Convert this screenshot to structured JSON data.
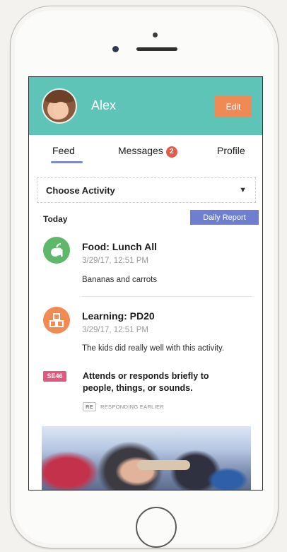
{
  "header": {
    "child_name": "Alex",
    "edit_label": "Edit"
  },
  "tabs": [
    {
      "label": "Feed",
      "active": true
    },
    {
      "label": "Messages",
      "badge": "2"
    },
    {
      "label": "Profile"
    }
  ],
  "filter": {
    "selected": "Choose Activity"
  },
  "feed": {
    "section_label": "Today",
    "daily_report_label": "Daily Report",
    "items": [
      {
        "title": "Food: Lunch All",
        "date": "3/29/17, 12:51 PM",
        "description": "Bananas and carrots",
        "icon": "apple-icon"
      },
      {
        "title": "Learning: PD20",
        "date": "3/29/17, 12:51 PM",
        "description": "The kids did really well with this activity.",
        "icon": "blocks-icon"
      }
    ],
    "milestone": {
      "tag": "SE46",
      "text": "Attends or responds briefly to people, things, or sounds.",
      "sub_code": "RE",
      "sub_label": "RESPONDING EARLIER"
    }
  },
  "colors": {
    "header_bg": "#5fc4b8",
    "edit_bg": "#f08a55",
    "tab_underline": "#7e8bd0",
    "badge_bg": "#e55b47",
    "daily_report_bg": "#6e7fcf",
    "food_icon_bg": "#5fb86a",
    "learning_icon_bg": "#f28a54",
    "tag_bg": "#e2587d"
  }
}
